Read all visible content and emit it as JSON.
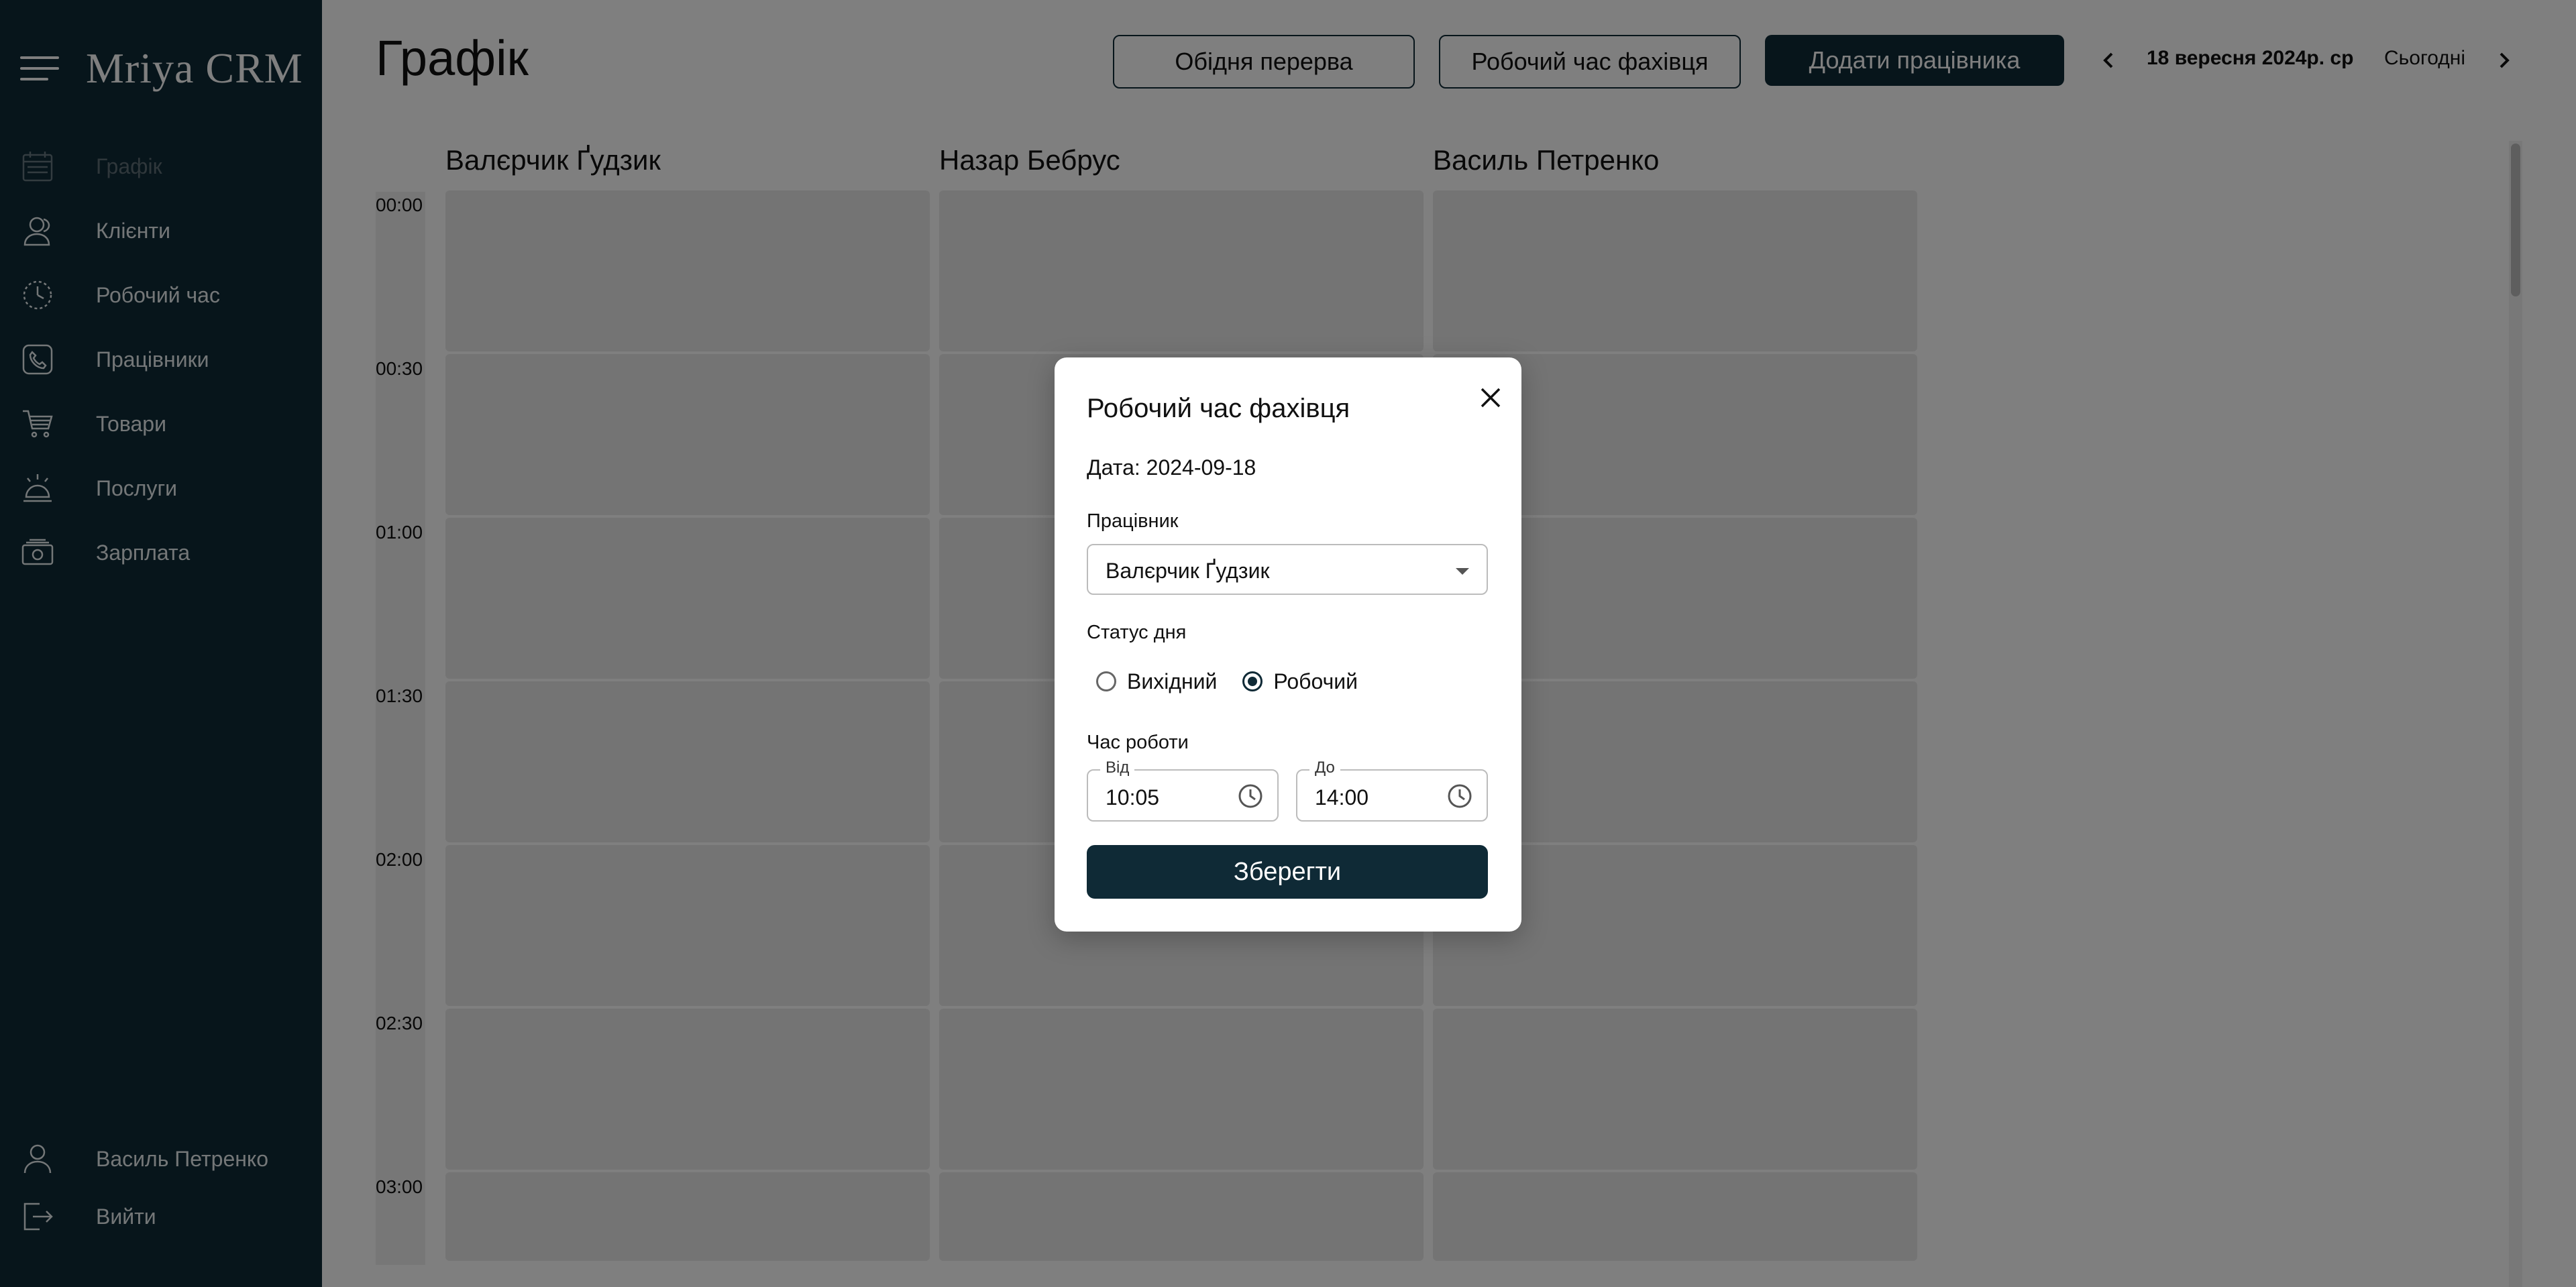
{
  "app": {
    "brand": "Mriya CRM"
  },
  "sidebar": {
    "items": [
      {
        "label": "Графік",
        "icon": "calendar-icon",
        "active": true
      },
      {
        "label": "Клієнти",
        "icon": "users-icon"
      },
      {
        "label": "Робочий час",
        "icon": "clock-icon"
      },
      {
        "label": "Працівники",
        "icon": "phone-icon"
      },
      {
        "label": "Товари",
        "icon": "cart-icon"
      },
      {
        "label": "Послуги",
        "icon": "service-bell-icon"
      },
      {
        "label": "Зарплата",
        "icon": "money-icon"
      }
    ],
    "bottom": [
      {
        "label": "Василь Петренко",
        "icon": "user-icon"
      },
      {
        "label": "Вийти",
        "icon": "logout-icon"
      }
    ]
  },
  "header": {
    "title": "Графік",
    "lunch_break": "Обідня перерва",
    "specialist_hours": "Робочий час фахівця",
    "add_employee": "Додати працівника",
    "date": "18 вересня 2024р. ср",
    "today": "Сьогодні"
  },
  "schedule": {
    "employees": [
      "Валєрчик Ґудзик",
      "Назар Бебрус",
      "Василь Петренко"
    ],
    "times": [
      "00:00",
      "00:30",
      "01:00",
      "01:30",
      "02:00",
      "02:30",
      "03:00"
    ]
  },
  "modal": {
    "title": "Робочий час фахівця",
    "date_text": "Дата: 2024-09-18",
    "employee_label": "Працівник",
    "employee_value": "Валєрчик Ґудзик",
    "status_label": "Статус дня",
    "status_options": [
      "Вихідний",
      "Робочий"
    ],
    "status_selected": "Робочий",
    "work_time_label": "Час роботи",
    "from_label": "Від",
    "from_value": "10:05",
    "to_label": "До",
    "to_value": "14:00",
    "save": "Зберегти"
  },
  "colors": {
    "primary": "#0f2a36",
    "overlay": "rgba(0,0,0,0.5)"
  }
}
